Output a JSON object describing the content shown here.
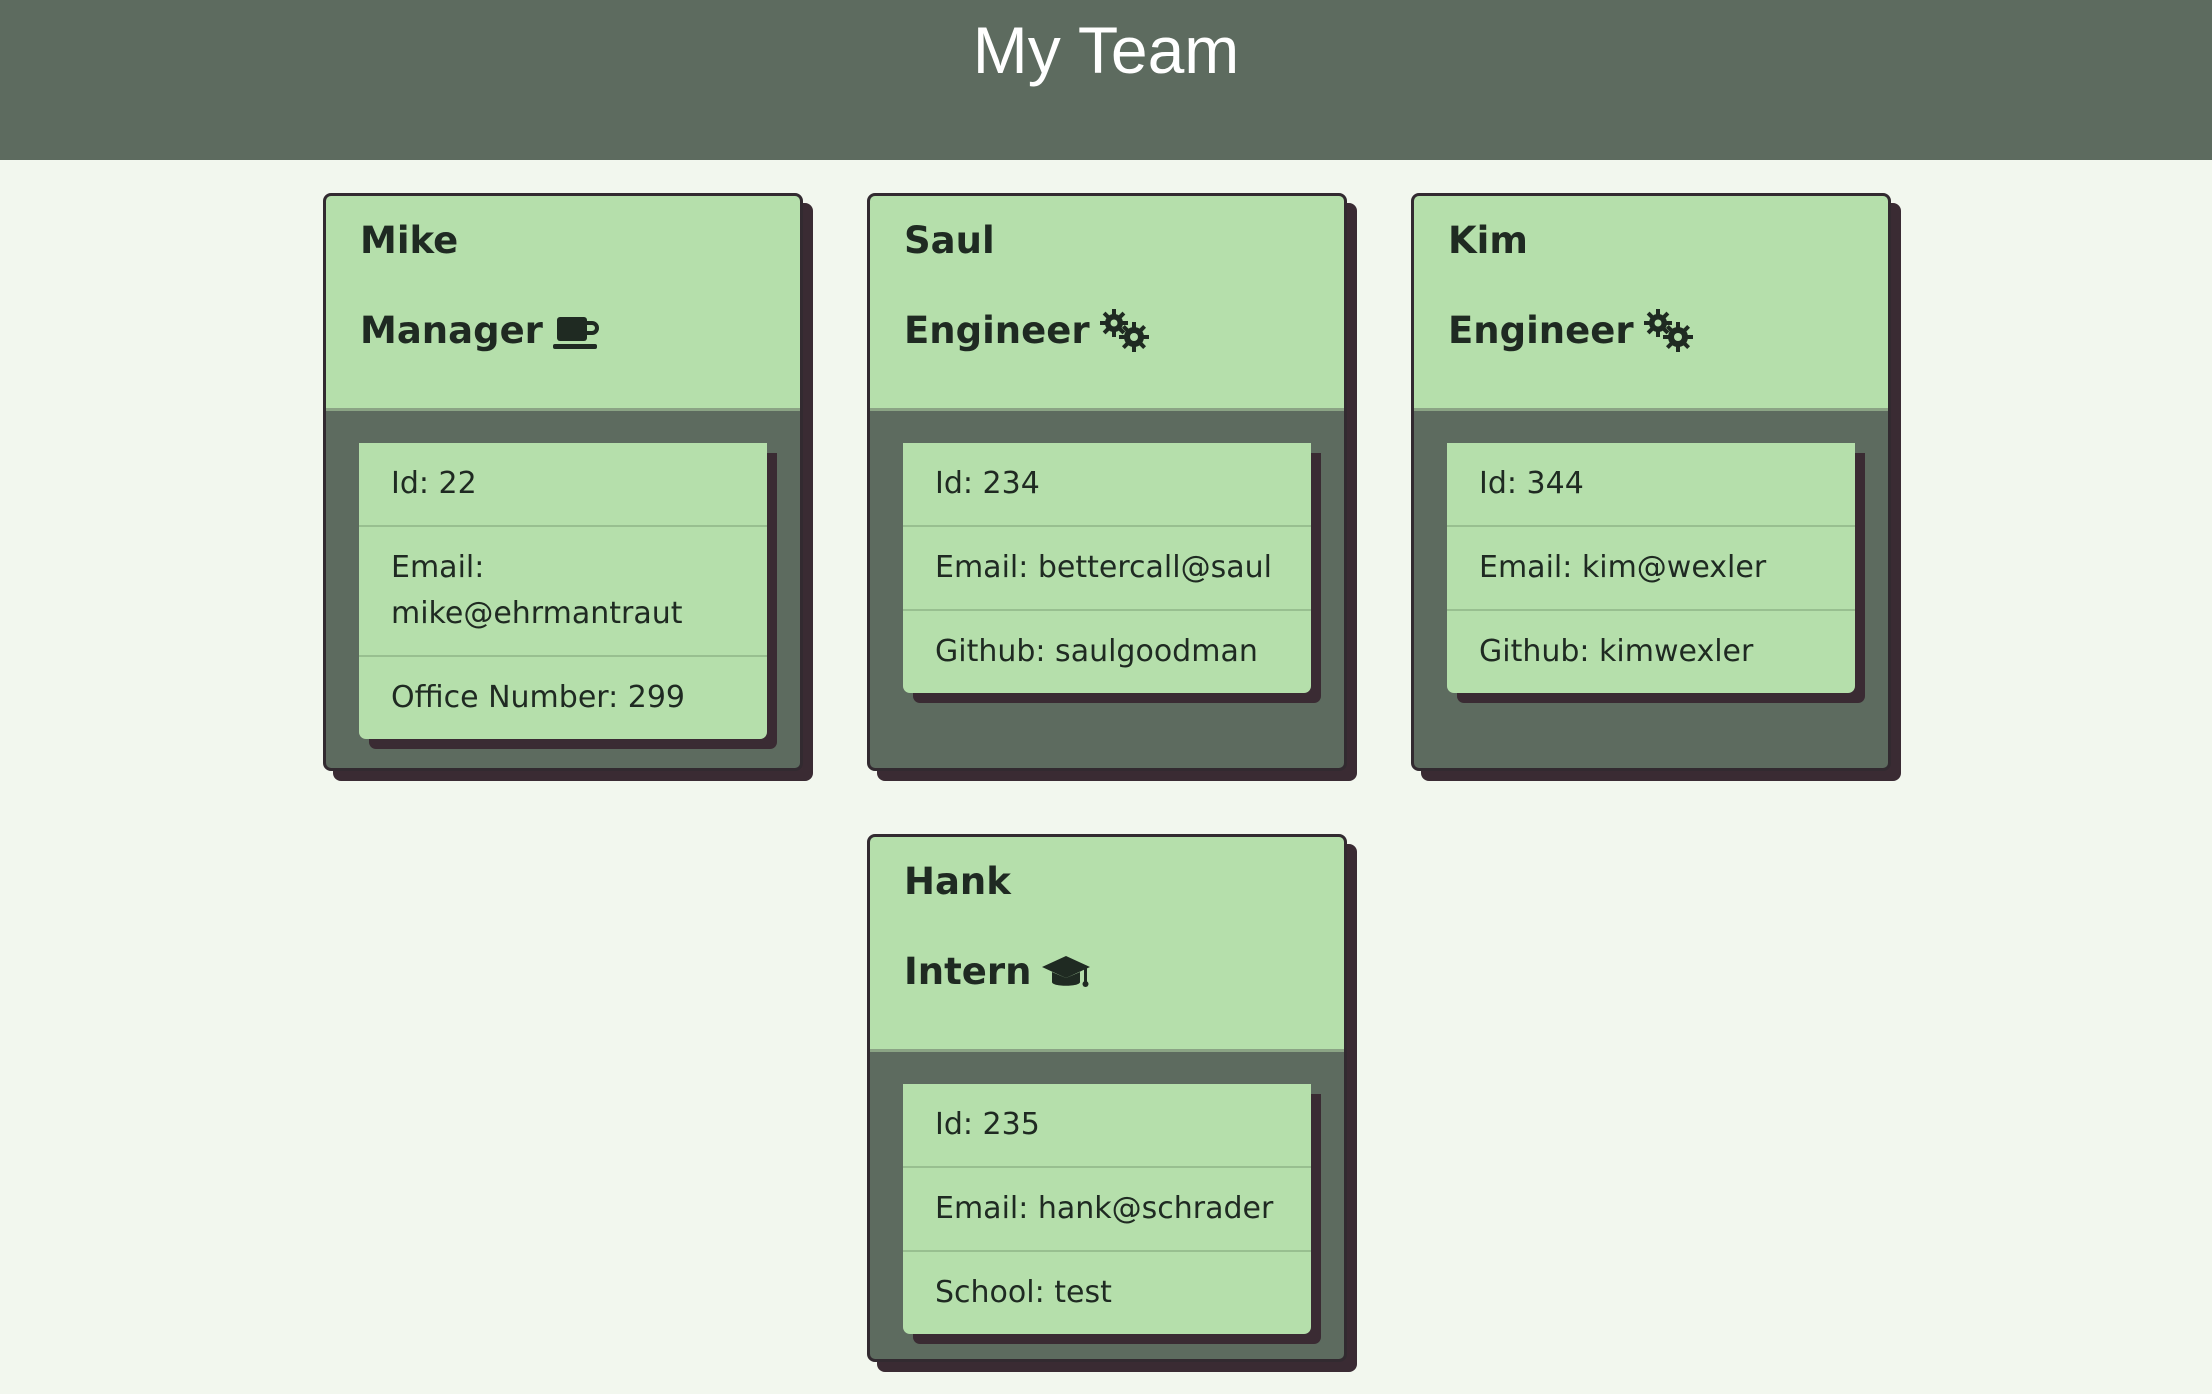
{
  "header": {
    "title": "My Team"
  },
  "colors": {
    "header_bg": "#5d6b5f",
    "page_bg": "#f2f7ee",
    "card_accent": "#b5dfab",
    "shadow": "#3a2b33"
  },
  "team": [
    {
      "name": "Mike",
      "role": "Manager",
      "icon": "coffee-mug-icon",
      "details": [
        "Id: 22",
        "Email: mike@ehrmantraut",
        "Office Number: 299"
      ]
    },
    {
      "name": "Saul",
      "role": "Engineer",
      "icon": "gears-icon",
      "details": [
        "Id: 234",
        "Email: bettercall@saul",
        "Github: saulgoodman"
      ]
    },
    {
      "name": "Kim",
      "role": "Engineer",
      "icon": "gears-icon",
      "details": [
        "Id: 344",
        "Email: kim@wexler",
        "Github: kimwexler"
      ]
    },
    {
      "name": "Hank",
      "role": "Intern",
      "icon": "graduation-cap-icon",
      "details": [
        "Id: 235",
        "Email: hank@schrader",
        "School: test"
      ]
    }
  ]
}
